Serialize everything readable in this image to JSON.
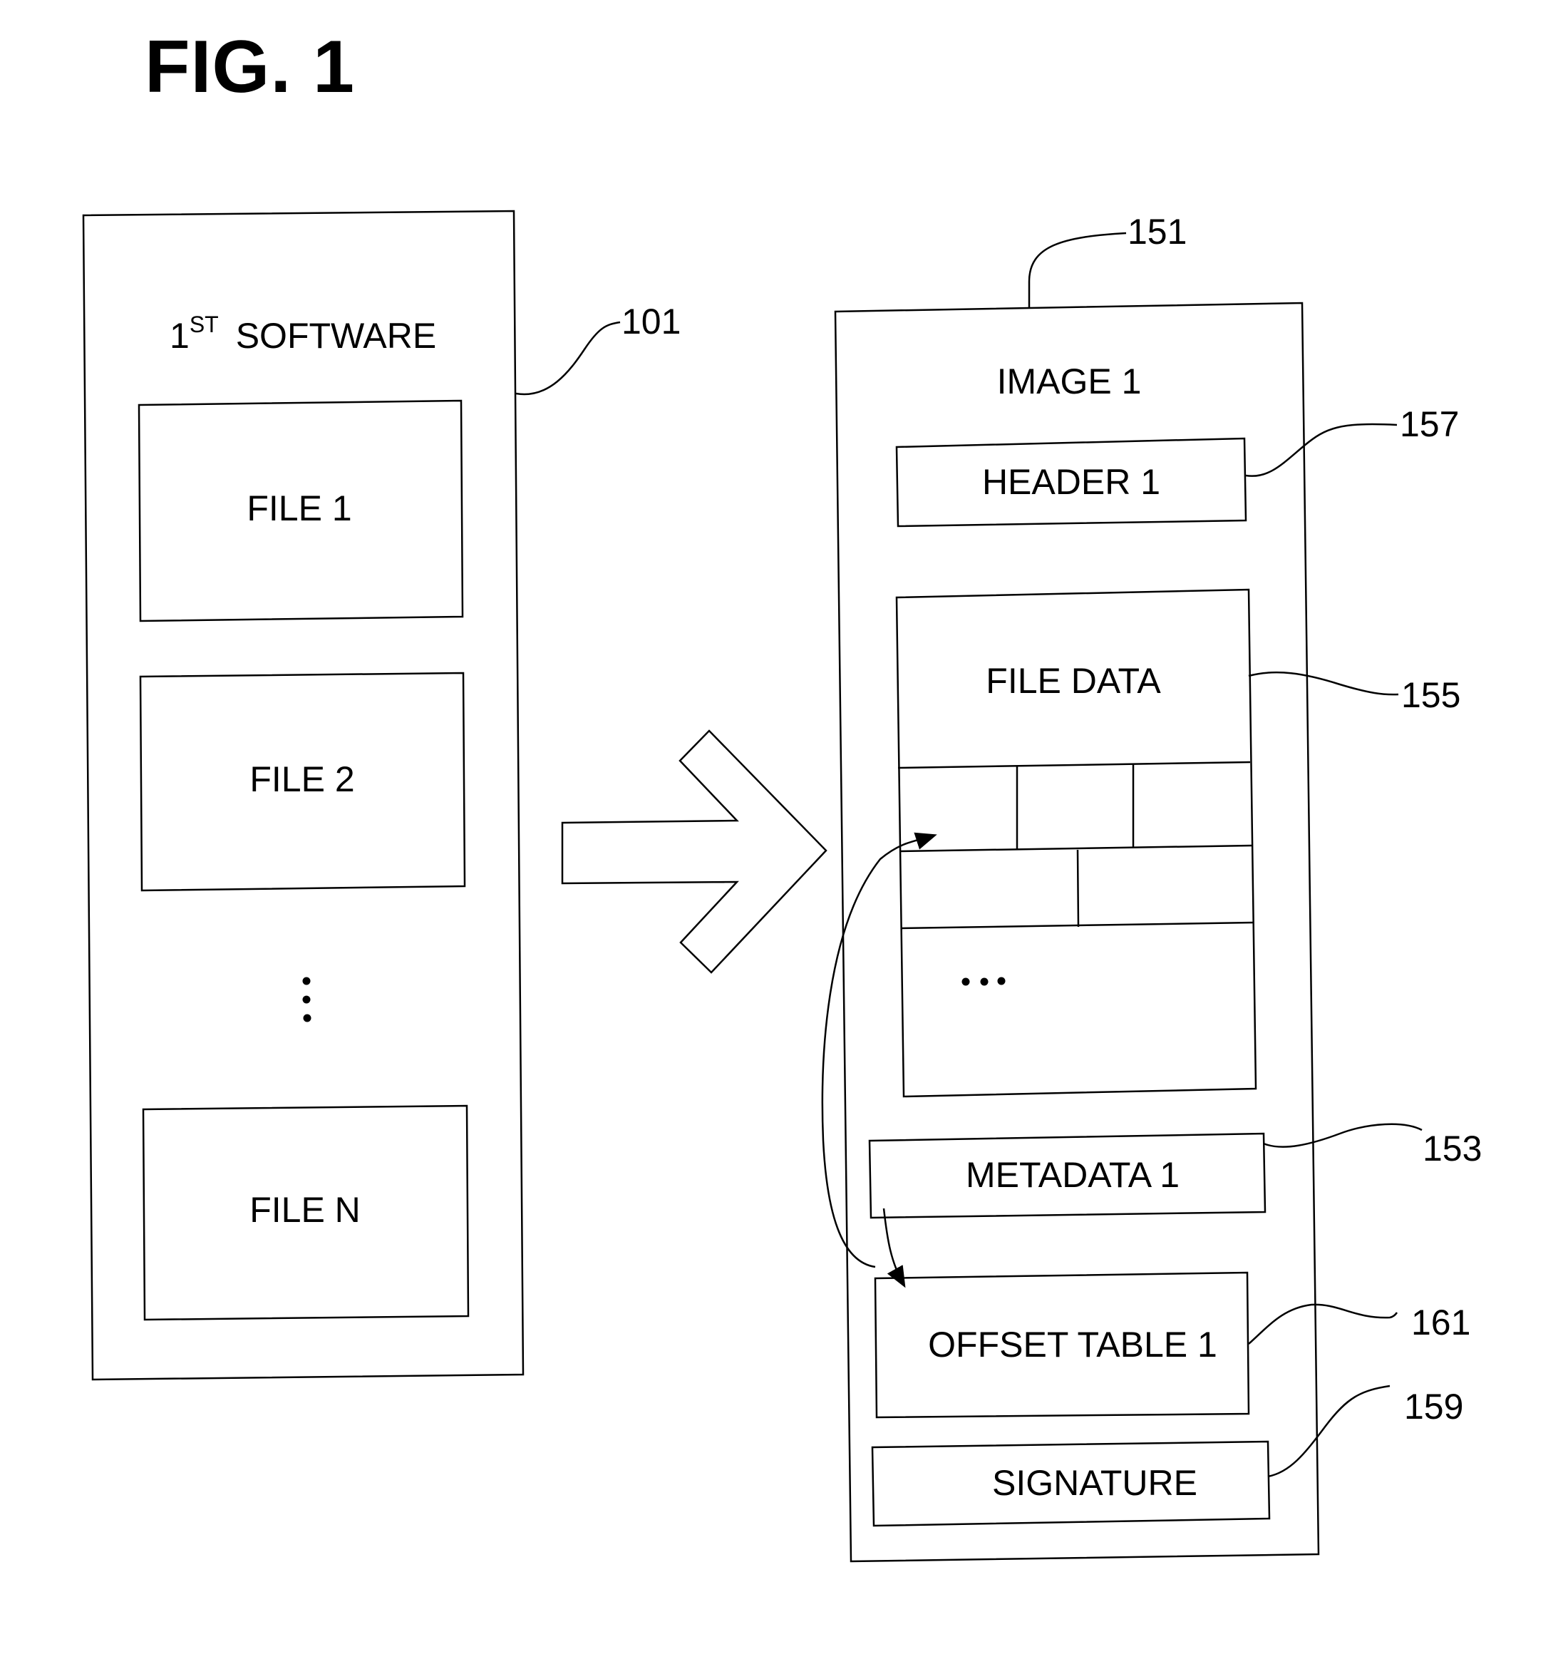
{
  "figure": {
    "title": "FIG. 1"
  },
  "left_block": {
    "title_prefix": "1",
    "title_superscript": "ST",
    "title_suffix": "SOFTWARE",
    "ref": "101",
    "files": [
      {
        "label": "FILE 1"
      },
      {
        "label": "FILE 2"
      },
      {
        "label": "FILE N"
      }
    ],
    "ellipsis": "vertical-dots"
  },
  "transform_arrow": {
    "icon": "block-arrow-right-icon"
  },
  "right_block": {
    "title": "IMAGE 1",
    "ref": "151",
    "header": {
      "label": "HEADER 1",
      "ref": "157"
    },
    "file_data": {
      "label": "FILE DATA",
      "ref": "155",
      "grid_rows": [
        3,
        2
      ],
      "ellipsis": "horizontal-dots"
    },
    "metadata": {
      "label": "METADATA 1",
      "ref": "153"
    },
    "offset_table": {
      "label": "OFFSET TABLE 1",
      "ref": "161"
    },
    "signature": {
      "label": "SIGNATURE",
      "ref": "159"
    }
  }
}
